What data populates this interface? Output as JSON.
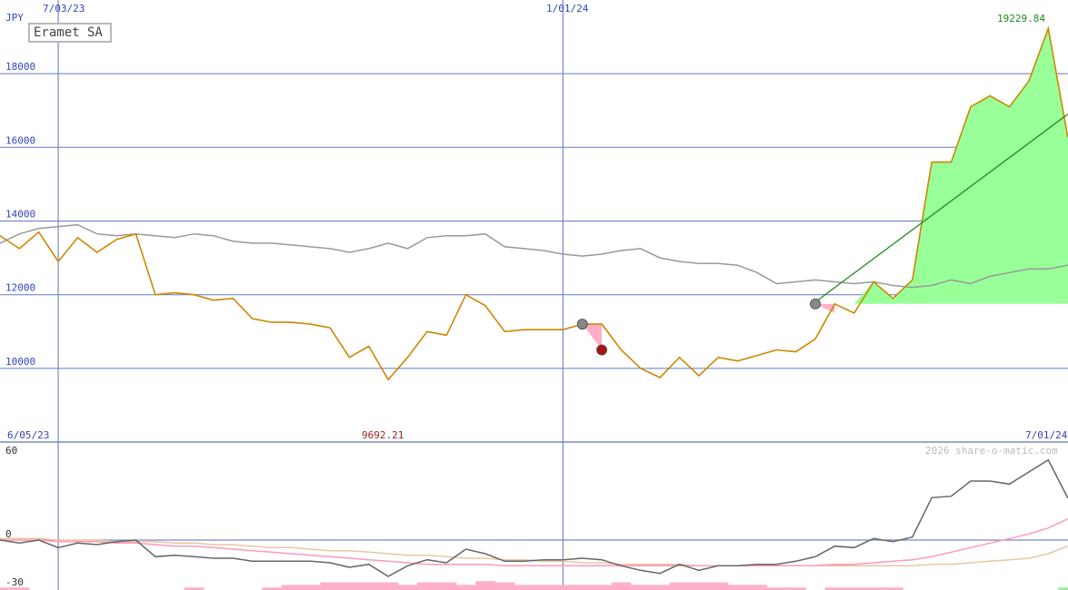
{
  "chart_data": {
    "type": "line",
    "title": "Eramet SA",
    "currency": "JPY",
    "copyright": "2026 share-o-matic.com",
    "top_date_labels": [
      "7/03/23",
      "1/01/24"
    ],
    "bottom_date_labels": [
      "6/05/23",
      "7/01/24"
    ],
    "max_label": "19229.84",
    "min_label": "9692.21",
    "price_panel": {
      "y_ticks": [
        10000,
        12000,
        14000,
        16000,
        18000
      ],
      "ylim": [
        8000,
        20000
      ],
      "x_range": [
        0,
        55
      ],
      "x_axis_markers": [
        {
          "x": 3,
          "label": "7/03/23"
        },
        {
          "x": 29,
          "label": "1/01/24"
        }
      ],
      "series": [
        {
          "role": "price",
          "color": "#cc8800",
          "values": [
            13600,
            13250,
            13700,
            12900,
            13550,
            13150,
            13500,
            13650,
            12000,
            12050,
            12000,
            11850,
            11900,
            11350,
            11250,
            11250,
            11200,
            11100,
            10300,
            10600,
            9692.21,
            10300,
            11000,
            10900,
            12000,
            11700,
            11000,
            11050,
            11050,
            11050,
            11200,
            11200,
            10500,
            10000,
            9750,
            10300,
            9800,
            10300,
            10200,
            10350,
            10500,
            10450,
            10800,
            11750,
            11500,
            12350,
            11900,
            12400,
            15600,
            15600,
            17100,
            17400,
            17100,
            17800,
            19229.84,
            16300,
            16900
          ]
        },
        {
          "role": "moving-average",
          "color": "#999999",
          "values": [
            13400,
            13650,
            13800,
            13850,
            13900,
            13650,
            13600,
            13650,
            13600,
            13550,
            13650,
            13600,
            13450,
            13400,
            13400,
            13350,
            13300,
            13250,
            13150,
            13250,
            13400,
            13250,
            13550,
            13600,
            13600,
            13650,
            13300,
            13250,
            13200,
            13100,
            13050,
            13100,
            13200,
            13250,
            13000,
            12900,
            12850,
            12850,
            12800,
            12600,
            12300,
            12350,
            12400,
            12350,
            12300,
            12350,
            12250,
            12200,
            12250,
            12400,
            12300,
            12500,
            12600,
            12700,
            12700,
            12800,
            13300
          ]
        }
      ],
      "trend_line": {
        "color": "#228822",
        "from": [
          42,
          11800
        ],
        "to": [
          55,
          16900
        ]
      },
      "markers": [
        {
          "x": 30,
          "y": 11200,
          "color": "#888888"
        },
        {
          "x": 31,
          "y": 10500,
          "color": "#aa1111"
        },
        {
          "x": 42,
          "y": 11750,
          "color": "#888888"
        }
      ],
      "gain_fill": {
        "color": "#99ff99",
        "from_x": 44,
        "baseline": 11750
      },
      "loss_fill": {
        "color": "#ffb0c8"
      }
    },
    "indicator_panel": {
      "y_ticks": [
        -30,
        0,
        60
      ],
      "ylim": [
        -30,
        60
      ],
      "series": [
        {
          "role": "momentum",
          "color": "#666666",
          "values": [
            0,
            -2,
            0,
            -5,
            -2,
            -3,
            -1,
            0,
            -11,
            -10,
            -11,
            -12,
            -12,
            -14,
            -14,
            -14,
            -14,
            -15,
            -18,
            -16,
            -24,
            -17,
            -13,
            -15,
            -6,
            -9,
            -14,
            -14,
            -13,
            -13,
            -12,
            -13,
            -17,
            -20,
            -22,
            -16,
            -20,
            -17,
            -17,
            -16,
            -16,
            -14,
            -11,
            -4,
            -5,
            1,
            -1,
            2,
            28,
            29,
            39,
            39,
            37,
            45,
            53,
            28,
            29
          ]
        },
        {
          "role": "signal-fast",
          "color": "#ff99bb",
          "values": [
            0,
            0,
            0,
            -1,
            -1,
            -1,
            -2,
            -2,
            -3,
            -4,
            -4,
            -5,
            -6,
            -7,
            -8,
            -9,
            -10,
            -11,
            -12,
            -13,
            -14,
            -15,
            -16,
            -16,
            -16,
            -16,
            -17,
            -17,
            -17,
            -17,
            -17,
            -17,
            -17,
            -17,
            -17,
            -17,
            -17,
            -17,
            -17,
            -17,
            -17,
            -17,
            -17,
            -16,
            -16,
            -15,
            -14,
            -13,
            -11,
            -8,
            -5,
            -2,
            1,
            4,
            8,
            14,
            17
          ]
        },
        {
          "role": "signal-slow",
          "color": "#e6c8a0",
          "values": [
            1,
            1,
            1,
            0,
            0,
            0,
            -1,
            -1,
            -1,
            -2,
            -2,
            -3,
            -3,
            -4,
            -5,
            -5,
            -6,
            -7,
            -7,
            -8,
            -9,
            -10,
            -10,
            -11,
            -12,
            -12,
            -13,
            -13,
            -14,
            -14,
            -15,
            -15,
            -16,
            -16,
            -16,
            -16,
            -17,
            -17,
            -17,
            -17,
            -17,
            -17,
            -17,
            -17,
            -17,
            -17,
            -17,
            -17,
            -16,
            -16,
            -15,
            -14,
            -13,
            -12,
            -9,
            -4,
            1
          ]
        }
      ],
      "volume_bars": {
        "color": "#ffb0c8",
        "green_color": "#99ee99",
        "values": [
          2,
          2,
          0,
          0,
          0,
          0,
          0,
          0,
          0,
          0,
          2,
          0,
          0,
          0,
          2,
          4,
          4,
          6,
          6,
          6,
          6,
          4,
          6,
          6,
          4,
          7,
          6,
          4,
          4,
          4,
          4,
          4,
          6,
          4,
          4,
          6,
          6,
          6,
          4,
          4,
          2,
          2,
          0,
          2,
          2,
          2,
          2,
          0,
          0,
          0,
          0,
          0,
          0,
          0,
          0,
          2,
          2
        ],
        "green_indices": [
          52,
          55
        ]
      }
    }
  },
  "colors": {
    "grid": "#7788cc",
    "axis_text": "#3344bb",
    "max_label": "#228822",
    "min_label": "#992222",
    "copyright": "#bbbbbb"
  }
}
